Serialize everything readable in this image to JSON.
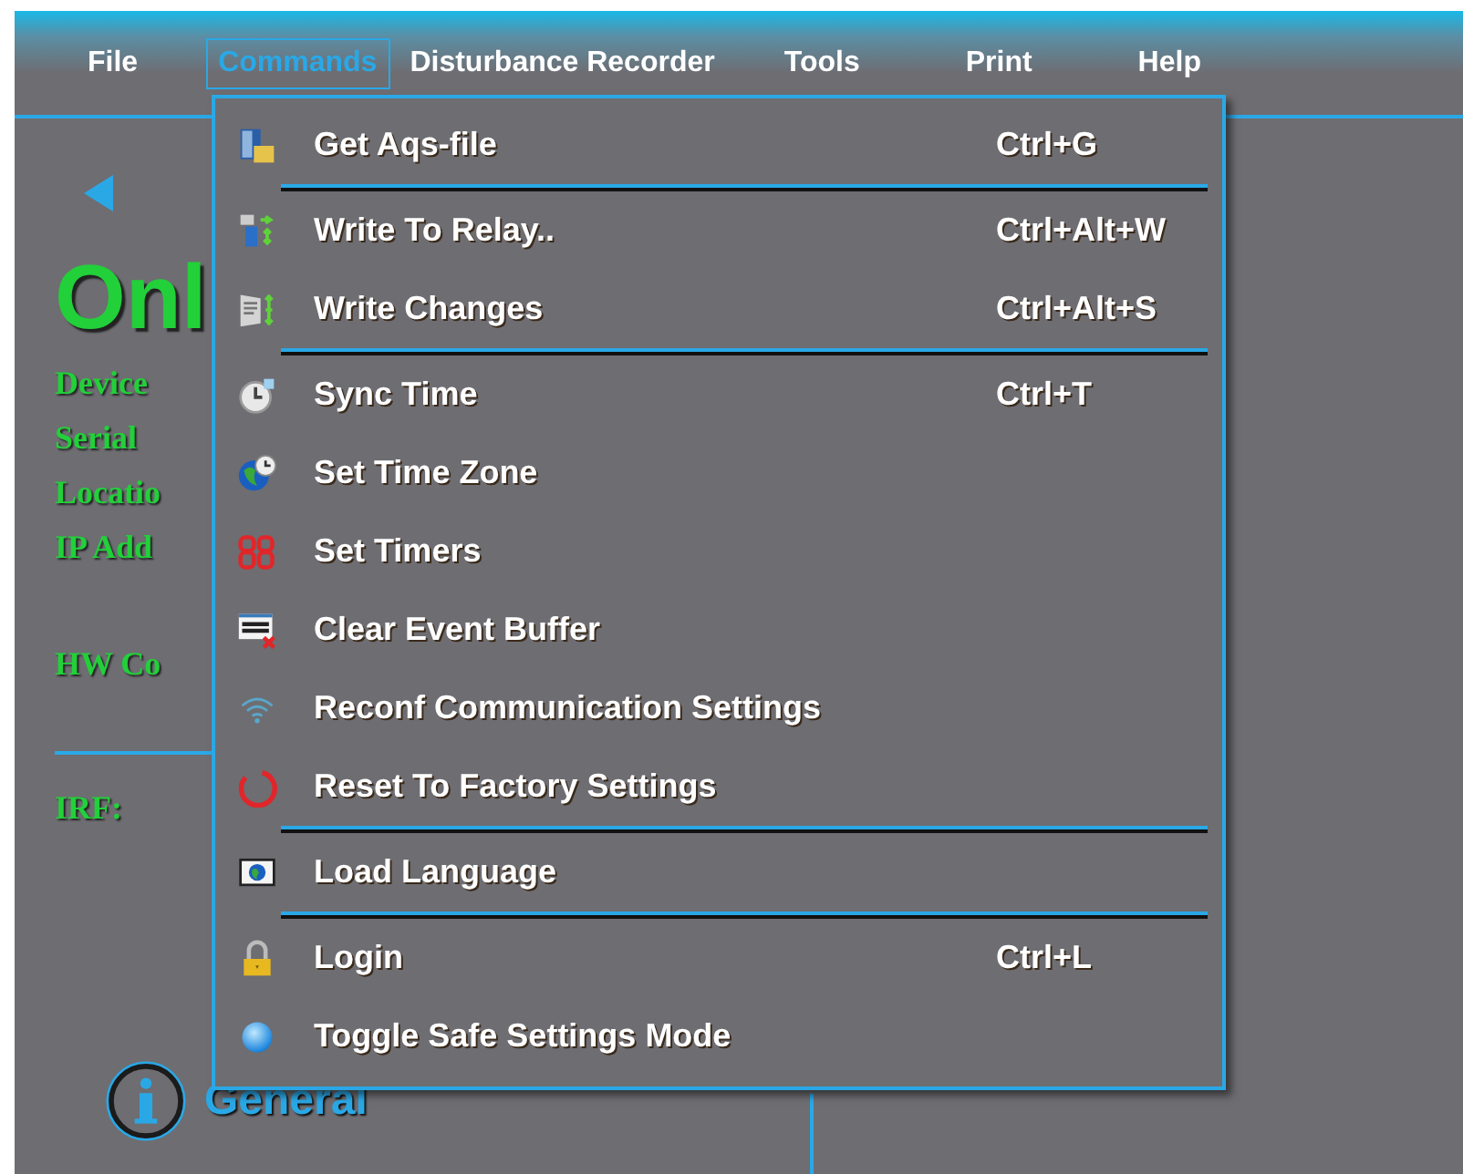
{
  "menubar": [
    {
      "label": "File",
      "selected": false
    },
    {
      "label": "Commands",
      "selected": true
    },
    {
      "label": "Disturbance Recorder",
      "selected": false
    },
    {
      "label": "Tools",
      "selected": false
    },
    {
      "label": "Print",
      "selected": false
    },
    {
      "label": "Help",
      "selected": false
    }
  ],
  "background": {
    "title": "Onl",
    "fields": [
      "Device",
      "Serial",
      "Locatio",
      "IP Add"
    ],
    "hw_label": "HW Co",
    "irf_label": "IRF:",
    "section": "General"
  },
  "menu": [
    {
      "kind": "item",
      "label": "Get Aqs-file",
      "shortcut": "Ctrl+G"
    },
    {
      "kind": "separator"
    },
    {
      "kind": "item",
      "label": "Write To Relay..",
      "shortcut": "Ctrl+Alt+W"
    },
    {
      "kind": "item",
      "label": "Write Changes",
      "shortcut": "Ctrl+Alt+S"
    },
    {
      "kind": "separator"
    },
    {
      "kind": "item",
      "label": "Sync Time",
      "shortcut": "Ctrl+T"
    },
    {
      "kind": "item",
      "label": "Set Time Zone"
    },
    {
      "kind": "item",
      "label": "Set Timers"
    },
    {
      "kind": "item",
      "label": "Clear Event Buffer"
    },
    {
      "kind": "item",
      "label": "Reconf Communication Settings"
    },
    {
      "kind": "item",
      "label": "Reset To Factory Settings"
    },
    {
      "kind": "separator"
    },
    {
      "kind": "item",
      "label": "Load Language"
    },
    {
      "kind": "separator"
    },
    {
      "kind": "item",
      "label": "Login",
      "shortcut": "Ctrl+L"
    },
    {
      "kind": "item",
      "label": "Toggle Safe Settings Mode"
    }
  ]
}
